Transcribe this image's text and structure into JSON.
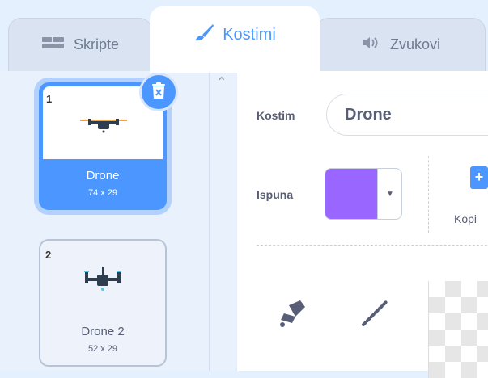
{
  "tabs": {
    "scripts": {
      "label": "Skripte",
      "icon": "code-blocks-icon"
    },
    "costumes": {
      "label": "Kostimi",
      "icon": "paintbrush-icon",
      "active": true
    },
    "sounds": {
      "label": "Zvukovi",
      "icon": "speaker-icon"
    }
  },
  "costume_list": {
    "items": [
      {
        "number": "1",
        "name": "Drone",
        "size": "74 x 29",
        "selected": true
      },
      {
        "number": "2",
        "name": "Drone 2",
        "size": "52 x 29",
        "selected": false
      }
    ]
  },
  "editor": {
    "costume_label": "Kostim",
    "costume_name": "Drone",
    "fill_label": "Ispuna",
    "fill_color": "#9966ff",
    "copy_label": "Kopi"
  },
  "colors": {
    "accent": "#4c97ff",
    "fill": "#9966ff",
    "text": "#575e75"
  }
}
